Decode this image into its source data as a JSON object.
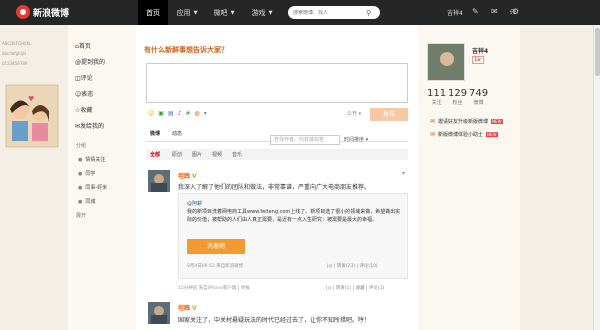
{
  "topbar": {
    "logo_text": "新浪微博",
    "nav": [
      {
        "label": "首页",
        "active": true,
        "caret": false
      },
      {
        "label": "应用",
        "active": false,
        "caret": true
      },
      {
        "label": "微吧",
        "active": false,
        "caret": true
      },
      {
        "label": "游戏",
        "active": false,
        "caret": true
      }
    ],
    "search_placeholder": "搜索微博、找人",
    "username": "吉祥4",
    "icons": [
      "edit-icon",
      "mail-icon",
      "bell-icon",
      "settings-icon"
    ]
  },
  "sidebar": {
    "items": [
      {
        "label": "首页",
        "icon": "home-icon",
        "glyph": "⌂"
      },
      {
        "label": "提到我的",
        "icon": "at-icon",
        "glyph": "@"
      },
      {
        "label": "评论",
        "icon": "comment-icon",
        "glyph": "◫"
      },
      {
        "label": "表态",
        "icon": "like-icon",
        "glyph": "☺"
      },
      {
        "label": "收藏",
        "icon": "star-icon",
        "glyph": "☆"
      },
      {
        "label": "发给我的",
        "icon": "mail-icon",
        "glyph": "✉"
      }
    ],
    "group_title": "分组",
    "groups": [
      "情情关注",
      "同学",
      "同事-虾米",
      "同城"
    ],
    "expand": "展开"
  },
  "compose": {
    "prompt": "有什么新鲜事想告诉大家？",
    "tools": [
      {
        "icon": "emoji-icon",
        "glyph": "☺",
        "color": "#f0a000"
      },
      {
        "icon": "image-icon",
        "glyph": "▣",
        "color": "#3a9a3a"
      },
      {
        "icon": "video-icon",
        "glyph": "▤",
        "color": "#3a6fc4"
      },
      {
        "icon": "music-icon",
        "glyph": "♪",
        "color": "#8a3ab9"
      },
      {
        "icon": "topic-icon",
        "glyph": "#",
        "color": "#3a9a3a"
      },
      {
        "icon": "vote-icon",
        "glyph": "◍",
        "color": "#e75a00"
      },
      {
        "icon": "more-icon",
        "glyph": "▾",
        "color": "#888"
      }
    ],
    "visibility": "公开 ▾",
    "publish": "发布"
  },
  "feed": {
    "tabs": [
      "微博",
      "动态"
    ],
    "search_placeholder": "查找作者、内容或标签",
    "sort_label": "时间排序 ▾",
    "filters": [
      "全部",
      "原创",
      "图片",
      "视频",
      "音乐"
    ]
  },
  "posts": [
    {
      "author": "坦践",
      "text": "我深入了解了他们的团队和做法，非常靠谱，严重向广大电商朋友推荐。",
      "repost": {
        "author": "@阿耕",
        "text": "我的新项目洗着网电商工具www.feiteng.com上线了。新项目选了很小的领域来做，希望做出实际的价值；被帮助的人们由人真正需要，是近有一点入生研究：被需要是最大的幸福。",
        "image_text": "洗着网 www.feiteng.com",
        "time": "9月4日09:52  来自新浪微博",
        "actions": "|◎  |  转发(23)  |  评论(10)"
      },
      "meta": "15分钟前  来自iPhone客户端  |  举报",
      "actions": "|◎  |  转发(1)  |  收藏  |  评论(1)"
    },
    {
      "author": "坦践",
      "text": "国家关注了，中关村悬疑玩法的时代已经过去了，让你不知所措吧。哼！"
    }
  ],
  "right": {
    "username": "吉祥4",
    "level": "Lv",
    "stats": [
      {
        "value": "111",
        "label": "关注"
      },
      {
        "value": "129",
        "label": "粉丝"
      },
      {
        "value": "749",
        "label": "微博"
      }
    ],
    "links": [
      {
        "label": "邀请好友升级新版微博",
        "badge": "NEW"
      },
      {
        "label": "新版微博体验小助士",
        "badge": "NEW"
      }
    ]
  }
}
